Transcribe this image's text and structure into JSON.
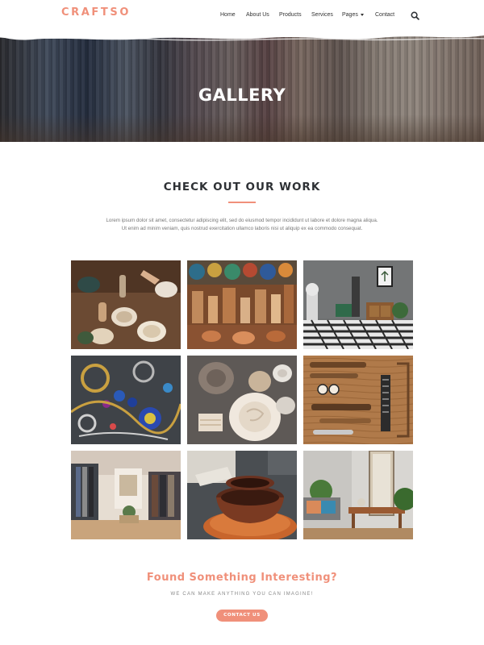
{
  "brand": {
    "name": "CRAFTSO",
    "accent": "#f0907a"
  },
  "nav": {
    "items": [
      {
        "label": "Home"
      },
      {
        "label": "About Us"
      },
      {
        "label": "Products"
      },
      {
        "label": "Services"
      },
      {
        "label": "Pages",
        "has_dropdown": true
      },
      {
        "label": "Contact"
      }
    ],
    "search_icon": "search-icon"
  },
  "hero": {
    "title": "GALLERY"
  },
  "section": {
    "title": "CHECK OUT OUR WORK",
    "intro_line1": "Lorem ipsum dolor sit amet, consectetur adipiscing elit, sed do eiusmod tempor incididunt ut labore et dolore magna aliqua.",
    "intro_line2": "Ut enim ad minim veniam, quis nostrud exercitation ullamco laboris nisi ut aliquip ex ea commodo consequat."
  },
  "gallery": {
    "images": [
      {
        "subject": "pottery-workshop"
      },
      {
        "subject": "market-ceramics"
      },
      {
        "subject": "living-room-interior"
      },
      {
        "subject": "jewelry"
      },
      {
        "subject": "ceramic-plates"
      },
      {
        "subject": "woodworking-tools"
      },
      {
        "subject": "clothing-boutique"
      },
      {
        "subject": "terracotta-bowls"
      },
      {
        "subject": "plant-corner-interior"
      }
    ]
  },
  "cta": {
    "title": "Found Something Interesting?",
    "subtitle": "WE CAN MAKE ANYTHING YOU CAN IMAGINE!",
    "button_label": "CONTACT US"
  }
}
